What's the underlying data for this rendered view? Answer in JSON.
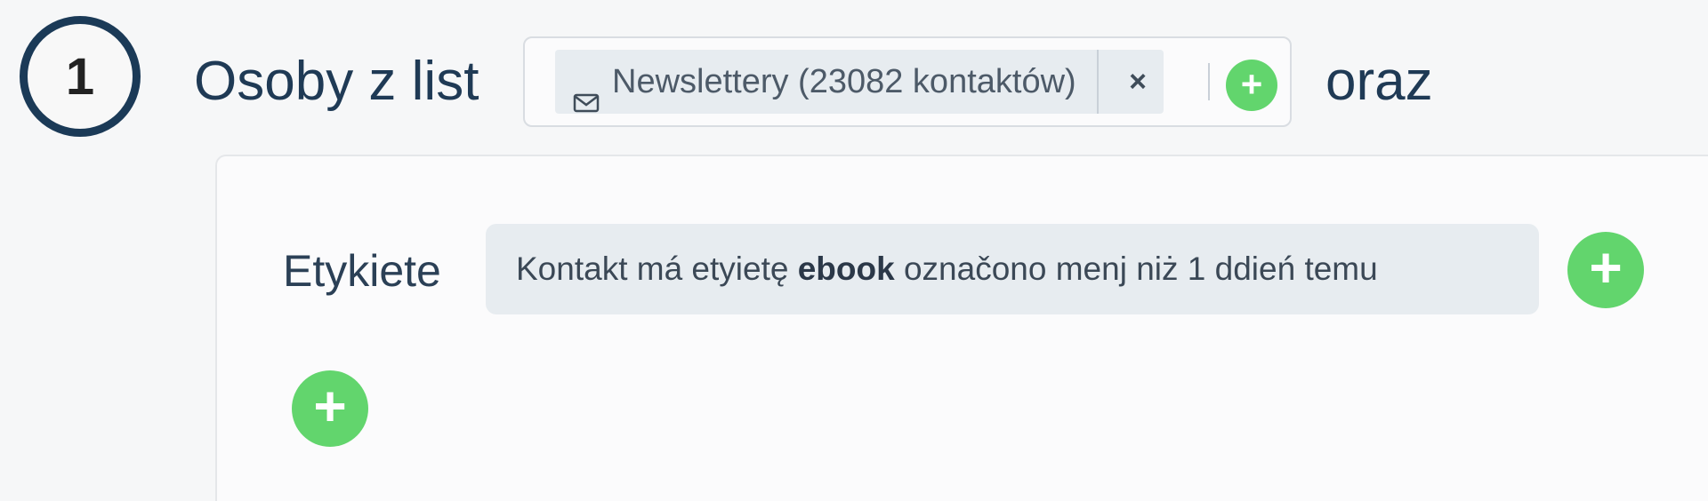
{
  "step": {
    "number": "1",
    "title": "Osoby z list",
    "connector": "oraz"
  },
  "list_selector": {
    "selected": {
      "icon": "mail-icon",
      "label": "Newslettery (23082 kontaktów)",
      "remove_label": "×"
    },
    "add_label": "+"
  },
  "conditions": {
    "label": "Etykiete",
    "items": [
      {
        "prefix": "Kontakt má etyietę ",
        "tag": "ebook",
        "suffix": " označono menj  niż 1 ddień temu"
      }
    ],
    "add_condition_label": "+",
    "add_group_label": "+"
  },
  "colors": {
    "accent_green": "#62d56d",
    "navy": "#1b3a57",
    "chip_bg": "#e7ecf0"
  }
}
